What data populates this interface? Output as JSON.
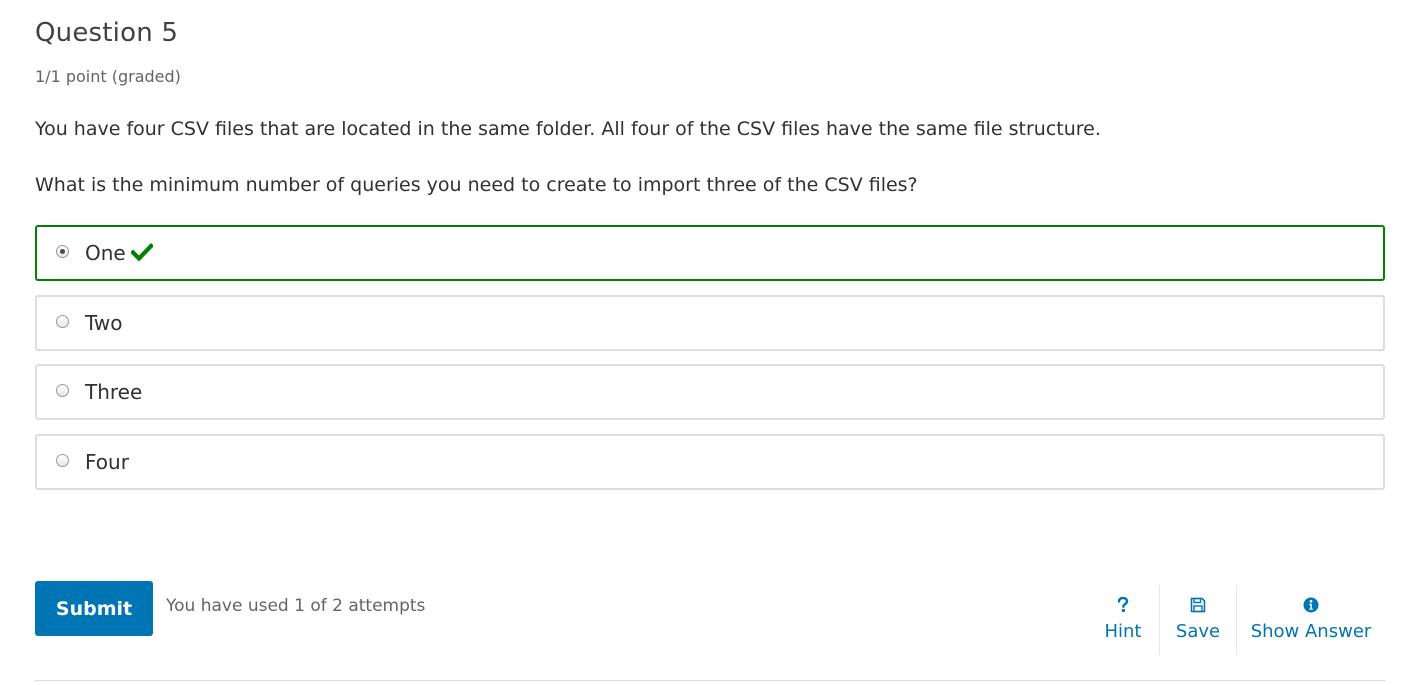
{
  "problem": {
    "title": "Question 5",
    "points": "1/1 point (graded)",
    "paragraphs": [
      "You have four CSV files that are located in the same folder. All four of the CSV files have the same file structure.",
      "What is the minimum number of queries you need to create to import three of the CSV files?"
    ]
  },
  "options": [
    {
      "label": "One",
      "selected": true,
      "status": "correct"
    },
    {
      "label": "Two",
      "selected": false
    },
    {
      "label": "Three",
      "selected": false
    },
    {
      "label": "Four",
      "selected": false
    }
  ],
  "footer": {
    "submit_label": "Submit",
    "attempts_text": "You have used 1 of 2 attempts",
    "actions": [
      {
        "label": "Hint",
        "icon": "question-mark-icon"
      },
      {
        "label": "Save",
        "icon": "floppy-disk-icon"
      },
      {
        "label": "Show Answer",
        "icon": "info-circle-icon"
      }
    ]
  },
  "colors": {
    "accent": "#0075b4",
    "correct": "#008100",
    "border": "#dddddd"
  }
}
